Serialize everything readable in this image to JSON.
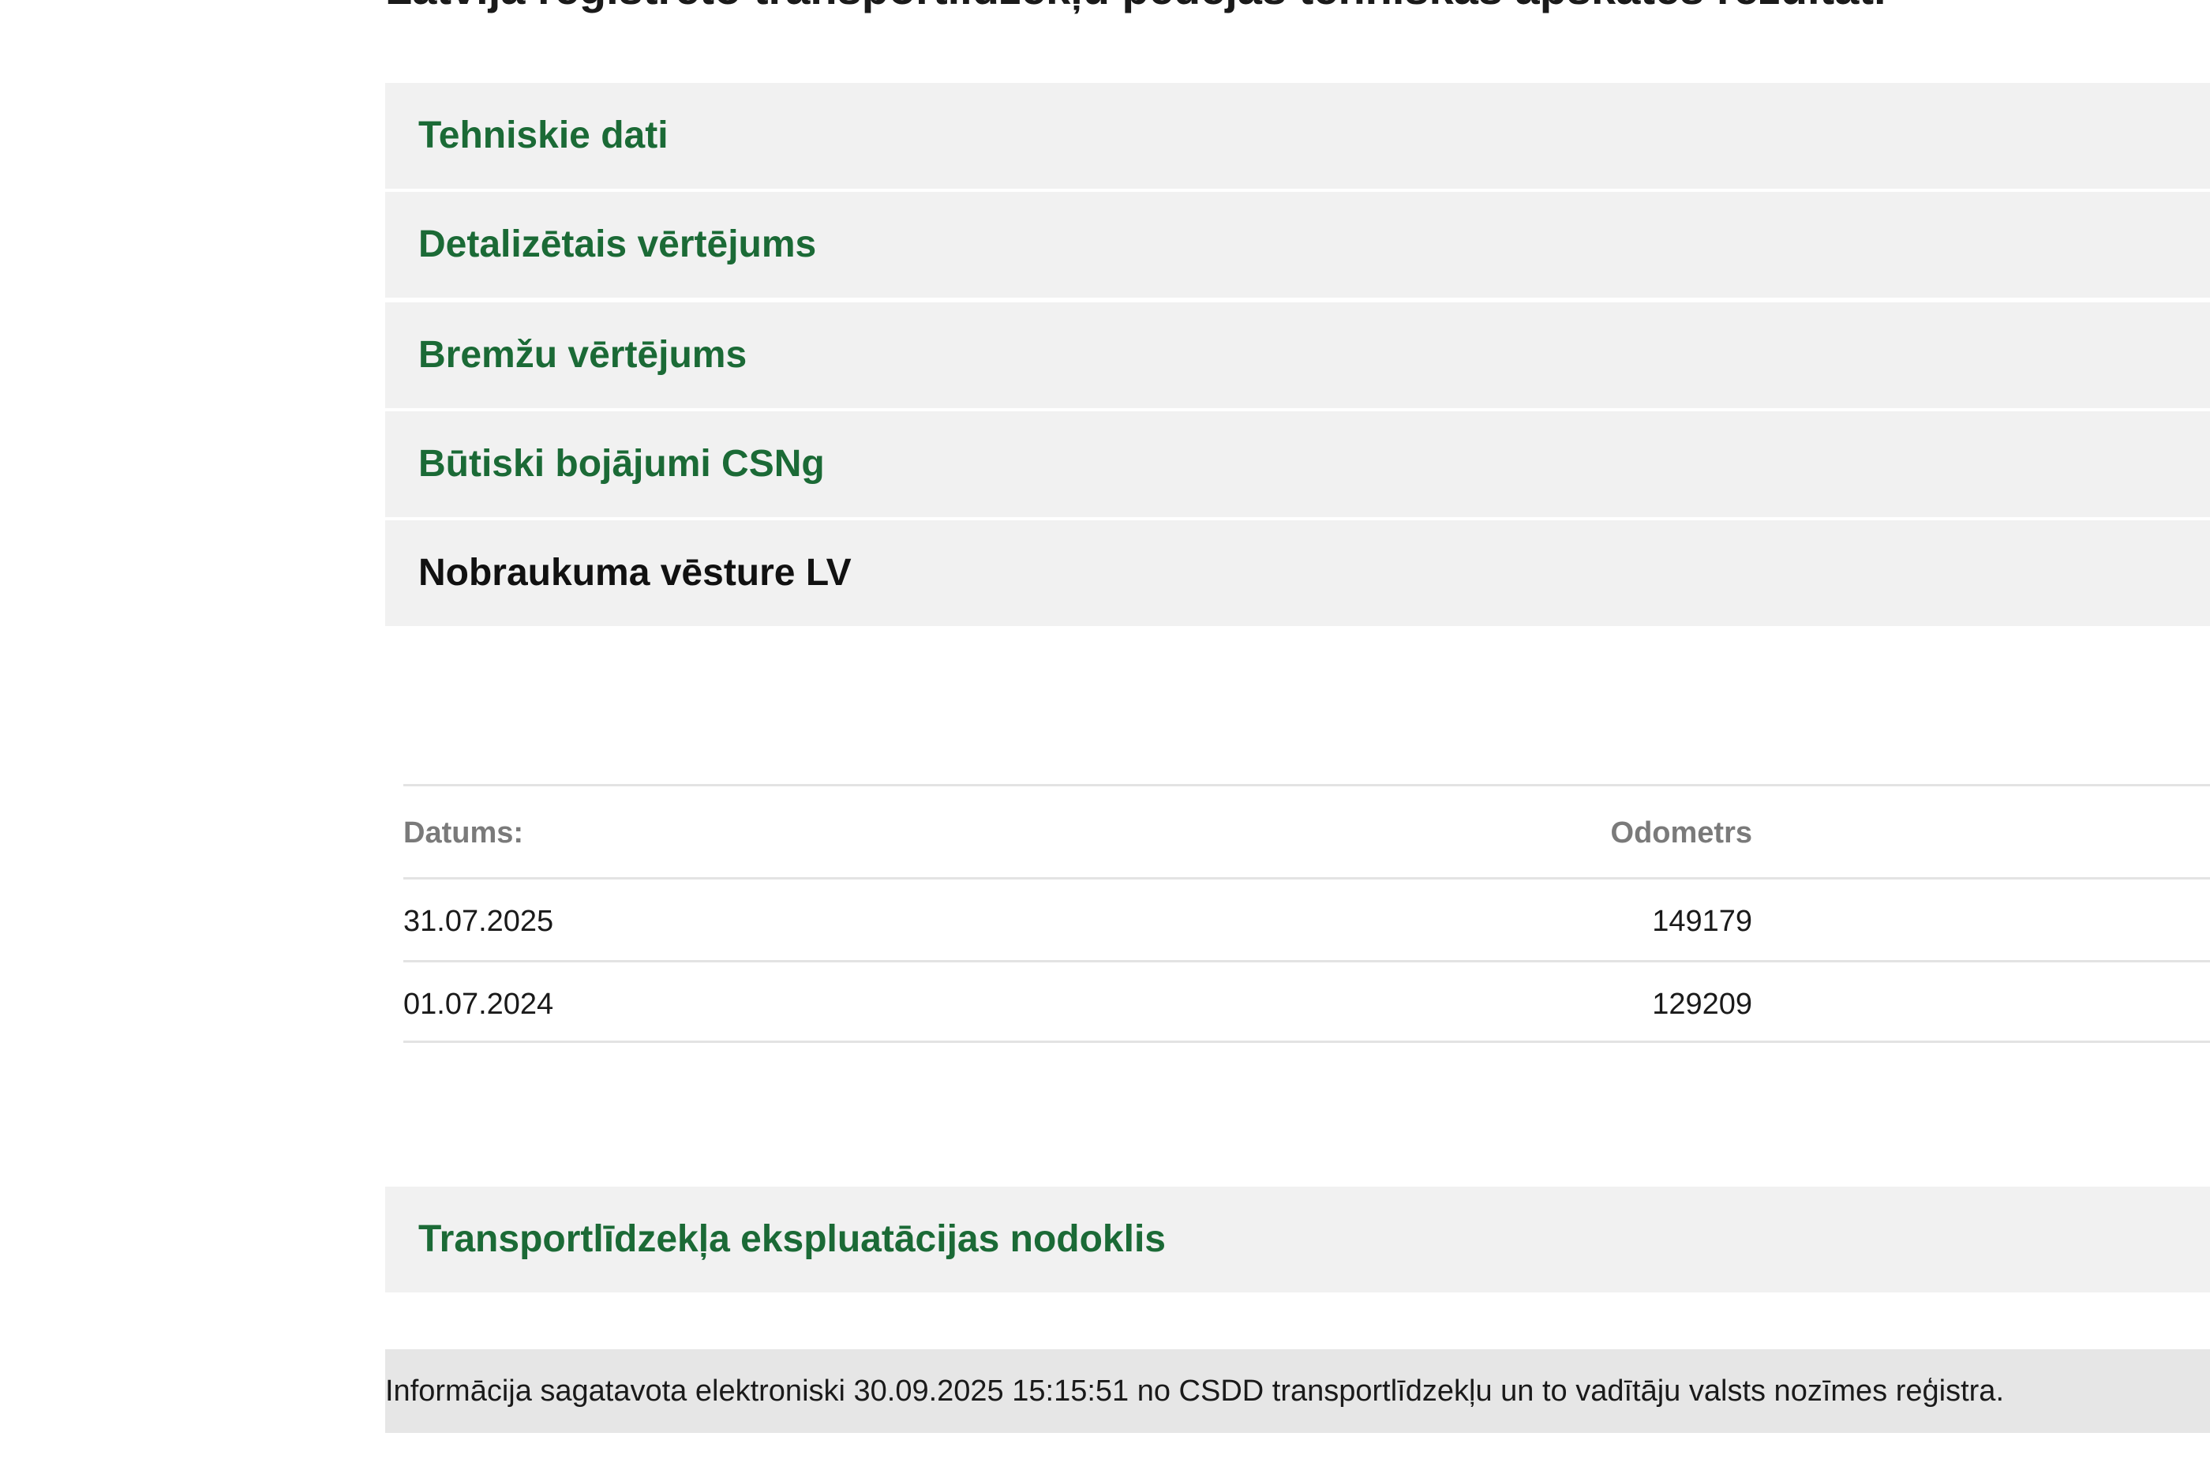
{
  "page": {
    "title": "Latvijā reģistrēto transportlīdzekļu pēdējās tehniskās apskates rezultāti"
  },
  "sections": {
    "technical_data": "Tehniskie dati",
    "detailed_assessment": "Detalizētais vērtējums",
    "brake_assessment": "Bremžu vērtējums",
    "significant_damage": "Būtiski bojājumi CSNg",
    "mileage_history": "Nobraukuma vēsture LV",
    "operation_tax": "Transportlīdzekļa ekspluatācijas nodoklis"
  },
  "mileage_table": {
    "headers": {
      "date": "Datums:",
      "odometer": "Odometrs"
    },
    "rows": [
      {
        "date": "31.07.2025",
        "odometer": "149179"
      },
      {
        "date": "01.07.2024",
        "odometer": "129209"
      }
    ]
  },
  "footer": {
    "note": "Informācija sagatavota elektroniski 30.09.2025 15:15:51 no CSDD transportlīdzekļu un to vadītāju valsts nozīmes reģistra."
  }
}
